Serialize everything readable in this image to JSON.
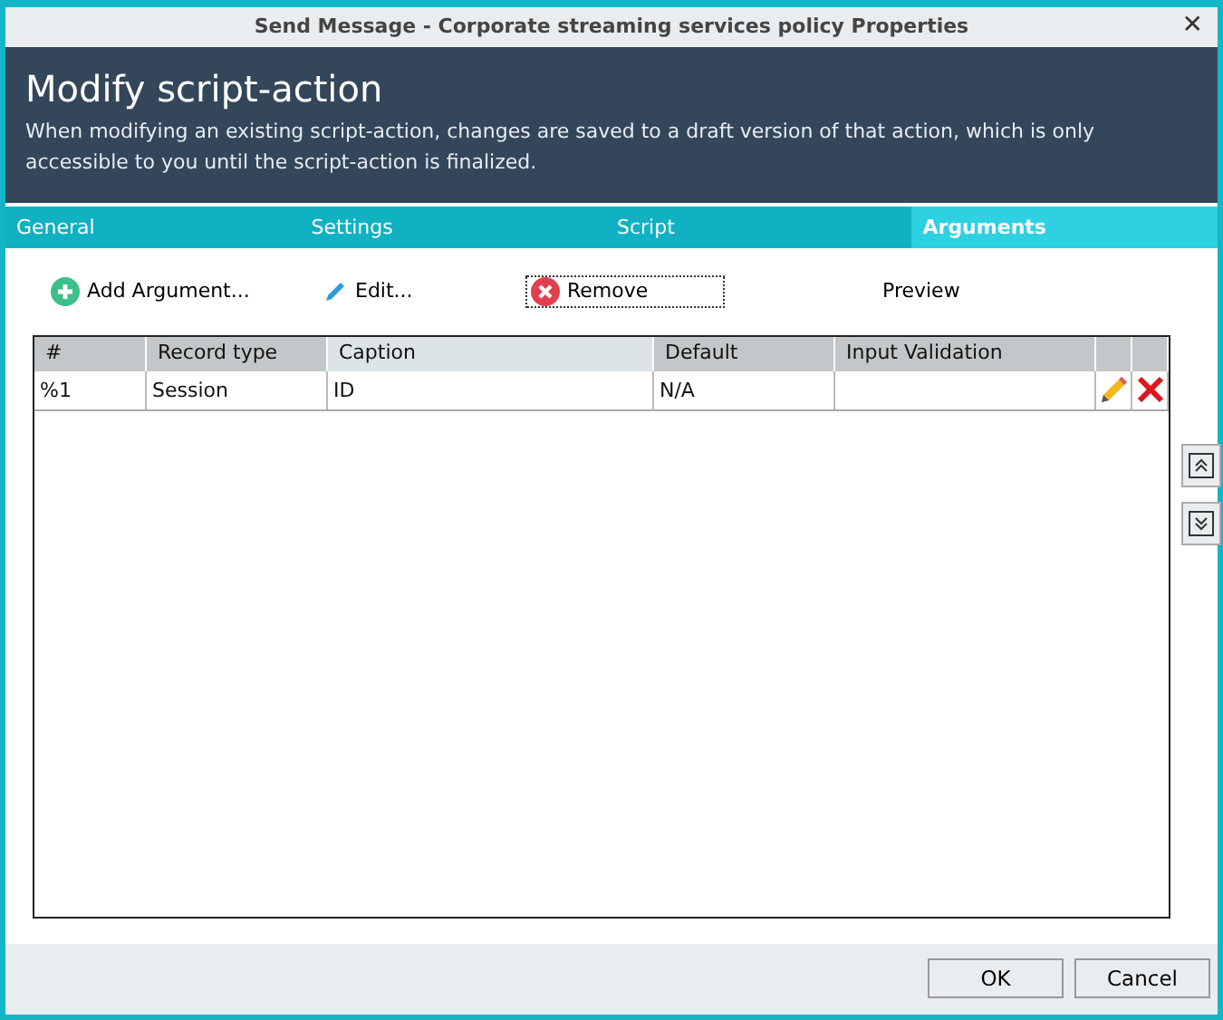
{
  "window": {
    "title": "Send Message - Corporate streaming services policy Properties",
    "close": "✕"
  },
  "header": {
    "title": "Modify script-action",
    "description": "When modifying an existing script-action, changes are saved to a draft version of that action, which is only accessible to you until the script-action is finalized."
  },
  "tabs": [
    {
      "label": "General",
      "selected": false
    },
    {
      "label": "Settings",
      "selected": false
    },
    {
      "label": "Script",
      "selected": false
    },
    {
      "label": "Arguments",
      "selected": true
    }
  ],
  "toolbar": [
    {
      "kind": "add",
      "label": "Add Argument..."
    },
    {
      "kind": "edit",
      "label": "Edit..."
    },
    {
      "kind": "remove",
      "label": "Remove",
      "focused": true
    },
    {
      "kind": "plain",
      "label": "Preview"
    }
  ],
  "table": {
    "columns": [
      {
        "label": "#",
        "selected": false
      },
      {
        "label": "Record type",
        "selected": false
      },
      {
        "label": "Caption",
        "selected": true
      },
      {
        "label": "Default",
        "selected": false
      },
      {
        "label": "Input Validation",
        "selected": false
      }
    ],
    "rows": [
      {
        "cells": [
          "%1",
          "Session",
          "ID",
          "N/A",
          ""
        ]
      }
    ]
  },
  "buttons": [
    {
      "label": "OK"
    },
    {
      "label": "Cancel"
    }
  ]
}
